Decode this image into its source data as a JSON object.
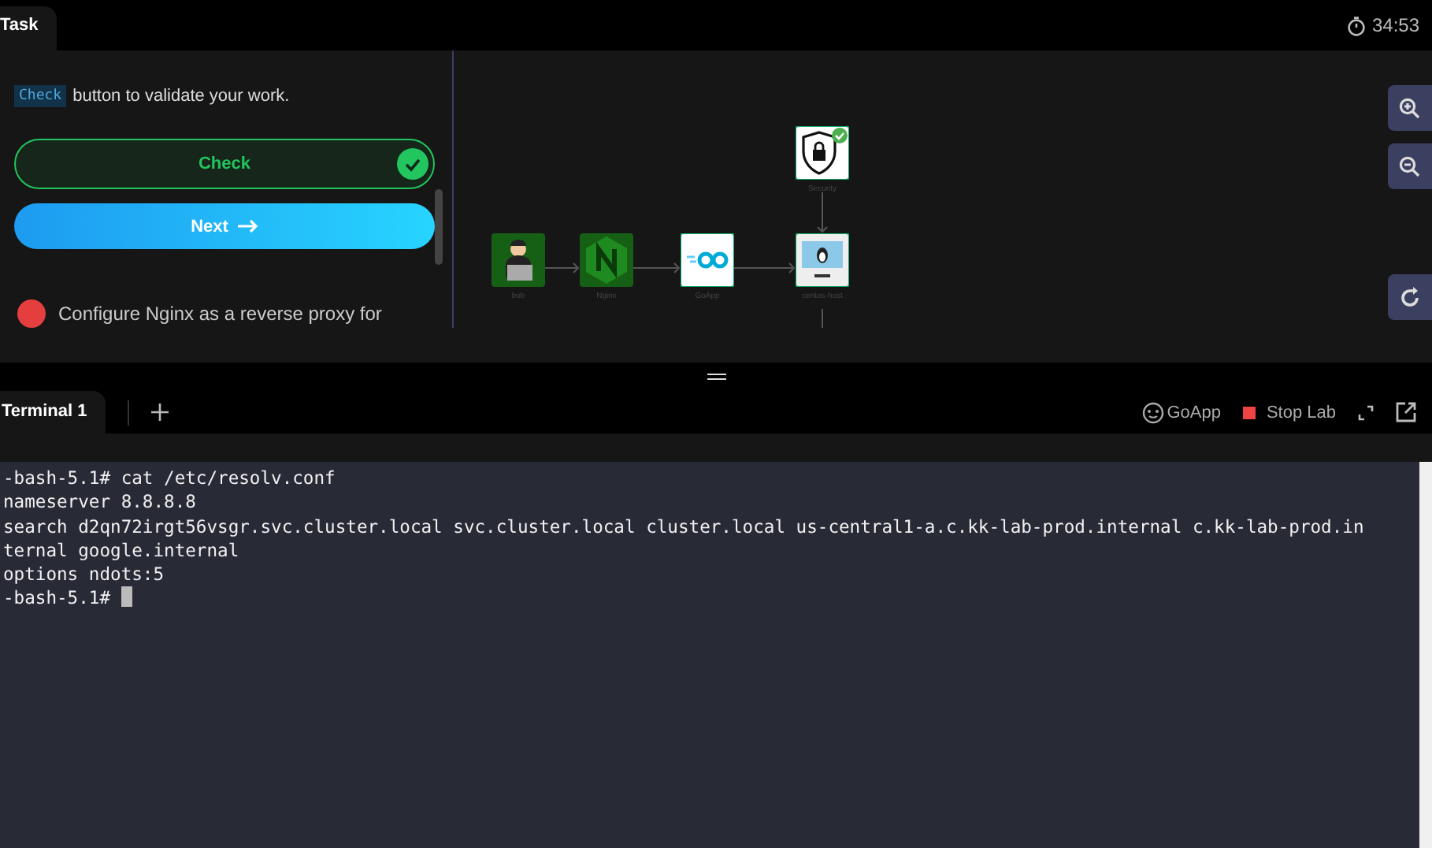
{
  "top_tab": {
    "label": "Task",
    "selected": true
  },
  "timer": "34:53",
  "task": {
    "code_word": "Check",
    "instruction": "button to validate your work.",
    "check_button": "Check",
    "check_passed": true,
    "next_button": "Next",
    "next_task": "Configure Nginx as a reverse proxy for"
  },
  "diagram": {
    "nodes": [
      {
        "label": "Security",
        "kind": "security"
      },
      {
        "label": "bob",
        "kind": "user"
      },
      {
        "label": "Nginx",
        "kind": "nginx"
      },
      {
        "label": "GoApp",
        "kind": "go"
      },
      {
        "label": "centos-host",
        "kind": "host"
      }
    ]
  },
  "terminal_tabs": [
    {
      "label": "Terminal 1",
      "selected": true
    }
  ],
  "toolbar": {
    "app_link": "GoApp",
    "stop_button": "Stop Lab"
  },
  "terminal_lines": [
    "-bash-5.1# cat /etc/resolv.conf",
    "nameserver 8.8.8.8",
    "search d2qn72irgt56vsgr.svc.cluster.local svc.cluster.local cluster.local us-central1-a.c.kk-lab-prod.internal c.kk-lab-prod.in",
    "ternal google.internal",
    "options ndots:5",
    "-bash-5.1# "
  ]
}
